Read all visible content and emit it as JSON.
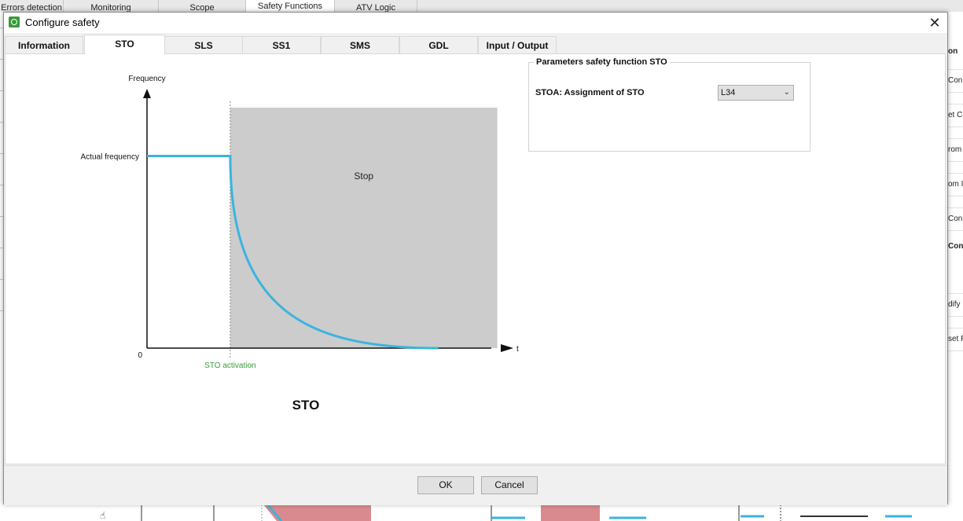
{
  "background_tabs": [
    "Errors detection",
    "Monitoring",
    "Scope",
    "Safety Functions",
    "ATV Logic"
  ],
  "background_right_panel": [
    "on",
    "Con",
    "et Co",
    "rom",
    "om I",
    "Con",
    "Conf",
    "dify I",
    "set F"
  ],
  "dialog": {
    "title": "Configure safety",
    "close_symbol": "✕"
  },
  "tabs": [
    "Information",
    "STO",
    "SLS",
    "SS1",
    "SMS",
    "GDL",
    "Input / Output"
  ],
  "active_tab": "STO",
  "chart_data": {
    "type": "line",
    "title": "STO",
    "ylabel": "Frequency",
    "xlabel": "t",
    "origin_label": "0",
    "y_marker_label": "Actual frequency",
    "x_marker_label": "STO activation",
    "region_label": "Stop",
    "series": [
      {
        "points": [
          [
            0,
            1.0
          ],
          [
            1,
            1.0
          ],
          [
            1.2,
            0.72
          ],
          [
            1.5,
            0.47
          ],
          [
            2.0,
            0.24
          ],
          [
            2.5,
            0.1
          ],
          [
            3.0,
            0.03
          ],
          [
            3.5,
            0.0
          ]
        ]
      }
    ],
    "xlim": [
      0,
      4.25
    ],
    "ylim": [
      0,
      1.35
    ],
    "stop_region": [
      1,
      3.5
    ],
    "colors": {
      "curve": "#3ab4e0",
      "region": "#cccccc",
      "activation_label": "#3a9a3a"
    }
  },
  "parameters": {
    "group_title": "Parameters safety function STO",
    "label": "STOA: Assignment of STO",
    "value": "L34"
  },
  "buttons": {
    "ok": "OK",
    "cancel": "Cancel"
  }
}
